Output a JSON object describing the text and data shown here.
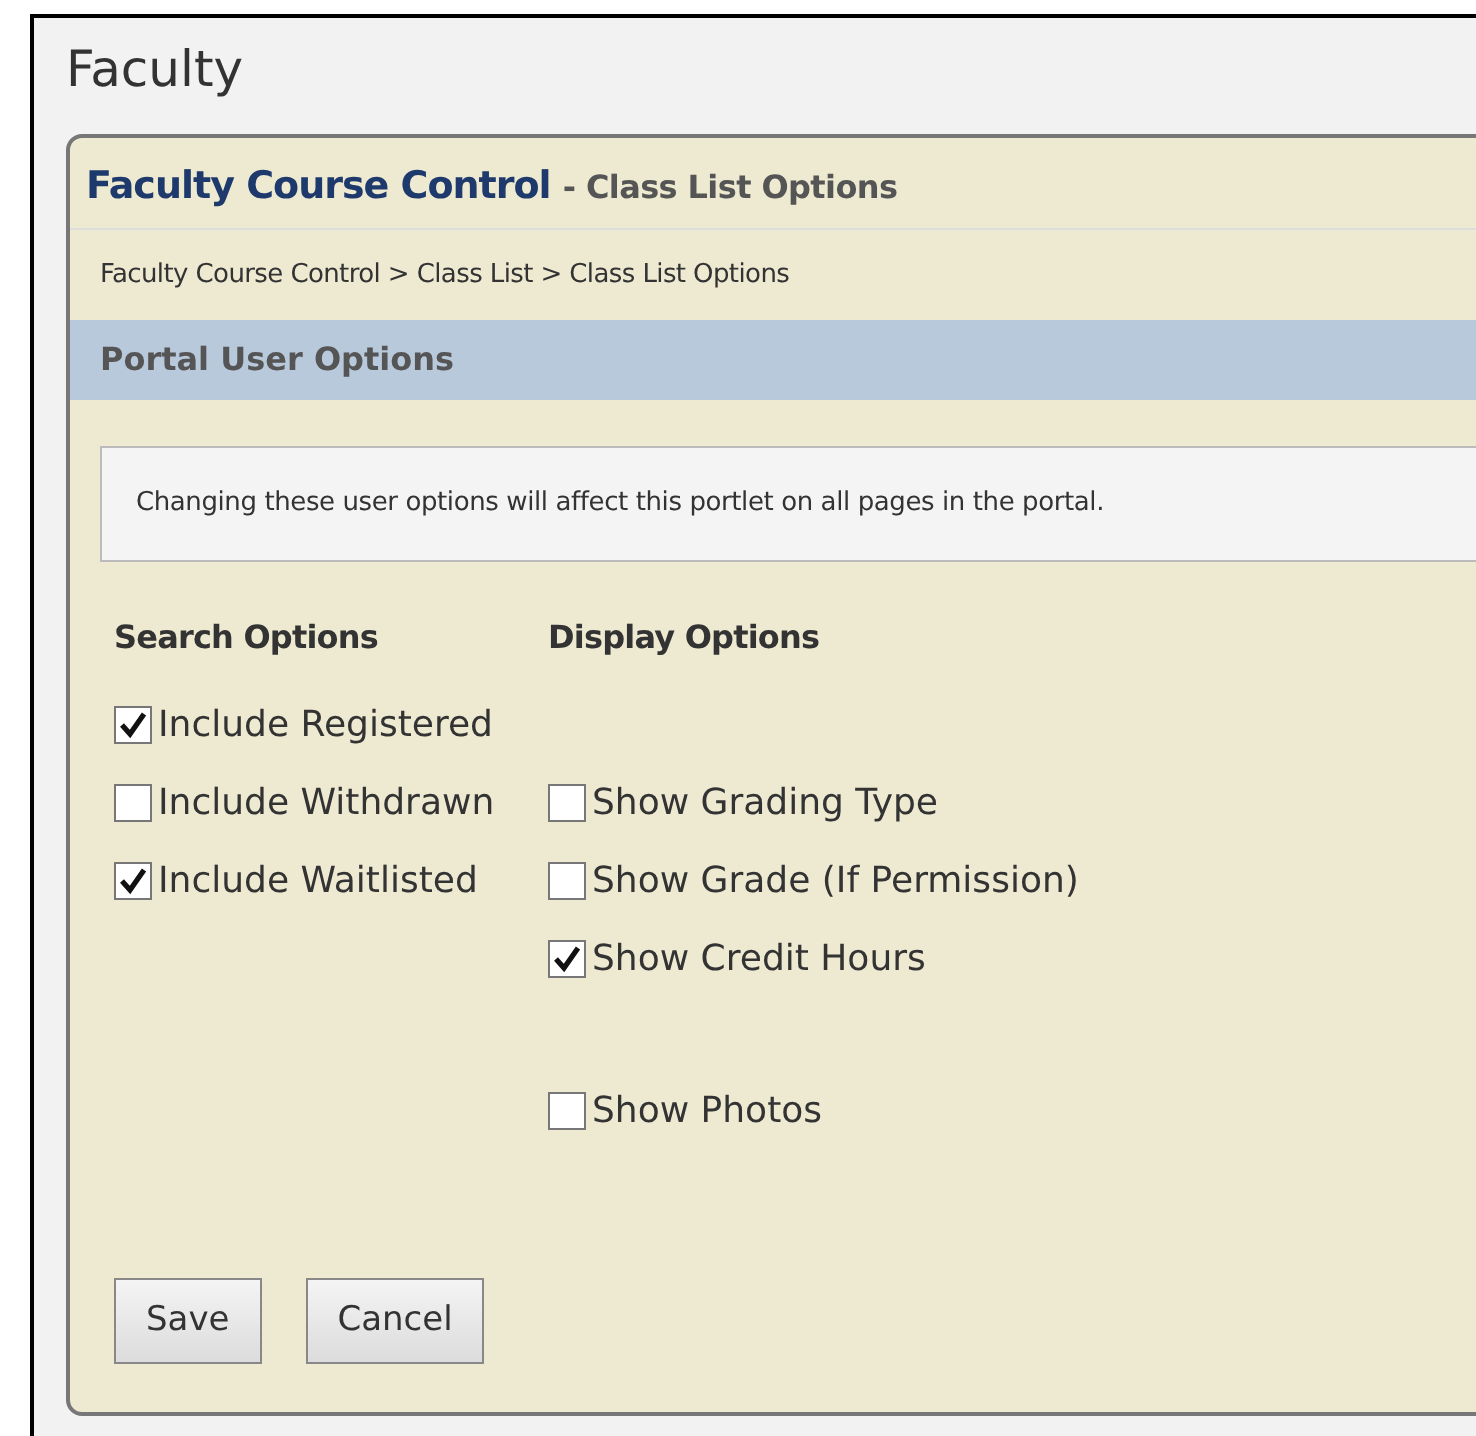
{
  "page_title": "Faculty",
  "portlet": {
    "title": "Faculty Course Control",
    "subtitle": "- Class List Options"
  },
  "breadcrumb": "Faculty Course Control > Class List > Class List Options",
  "section_title": "Portal User Options",
  "notice": "Changing these user options will affect this portlet on all pages in the portal.",
  "search_options": {
    "heading": "Search Options",
    "items": [
      {
        "label": "Include Registered",
        "checked": true
      },
      {
        "label": "Include Withdrawn",
        "checked": false
      },
      {
        "label": "Include Waitlisted",
        "checked": true
      }
    ]
  },
  "display_options": {
    "heading": "Display Options",
    "items": [
      {
        "label": "Show Grading Type",
        "checked": false
      },
      {
        "label": "Show Grade (If Permission)",
        "checked": false
      },
      {
        "label": "Show Credit Hours",
        "checked": true
      },
      {
        "label": "Show Photos",
        "checked": false
      }
    ]
  },
  "buttons": [
    "Save",
    "Cancel"
  ]
}
